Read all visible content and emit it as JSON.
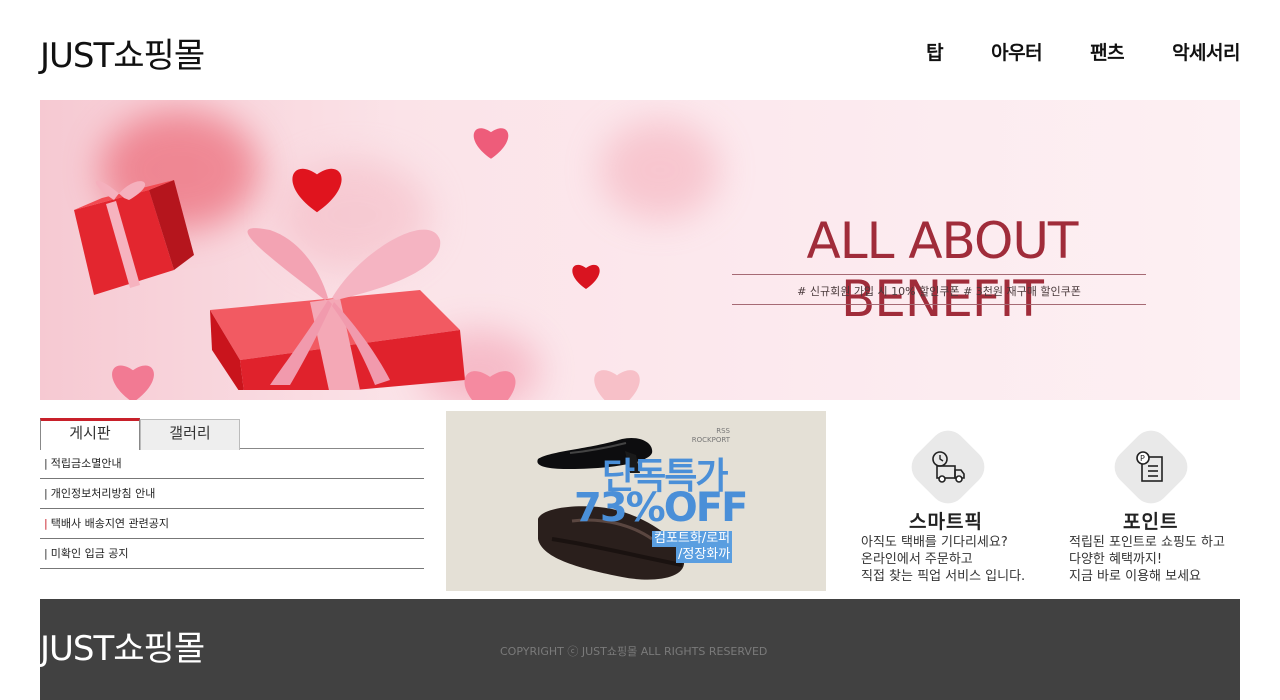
{
  "header": {
    "logo": "JUST쇼핑몰",
    "nav": [
      "탑",
      "아우터",
      "팬츠",
      "악세서리"
    ]
  },
  "banner": {
    "title": "ALL ABOUT BENEFIT",
    "subtitle": "# 신규회원 가입 시 10% 할인쿠폰 # 3천원 재구매 할인쿠폰"
  },
  "board": {
    "tabs": [
      "게시판",
      "갤러리"
    ],
    "items": [
      "적립금소멸안내",
      "개인정보처리방침 안내",
      "택배사 배송지연 관련공지",
      "미확인 입금 공지"
    ]
  },
  "promo": {
    "brand_top": "RSS",
    "brand": "ROCKPORT",
    "title": "단독특가",
    "discount": "73%OFF",
    "tag1": "컴포트화/로퍼",
    "tag2": "/정장화까"
  },
  "services": [
    {
      "title": "스마트픽",
      "icon": "truck-clock-icon",
      "lines": [
        "아직도 택배를 기다리세요?",
        "온라인에서 주문하고",
        "직접 찾는 픽업 서비스 입니다."
      ]
    },
    {
      "title": "포인트",
      "icon": "point-receipt-icon",
      "lines": [
        "적립된 포인트로 쇼핑도 하고",
        "다양한 혜택까지!",
        "지금 바로 이용해 보세요"
      ]
    }
  ],
  "footer": {
    "logo": "JUST쇼핑몰",
    "copyright": "COPYRIGHT ⓒ JUST쇼핑몰 ALL RIGHTS RESERVED"
  },
  "colors": {
    "accent": "#c8202a",
    "banner_title": "#a02c3a",
    "promo_blue": "#4a8fd8",
    "footer_bg": "#414141"
  }
}
